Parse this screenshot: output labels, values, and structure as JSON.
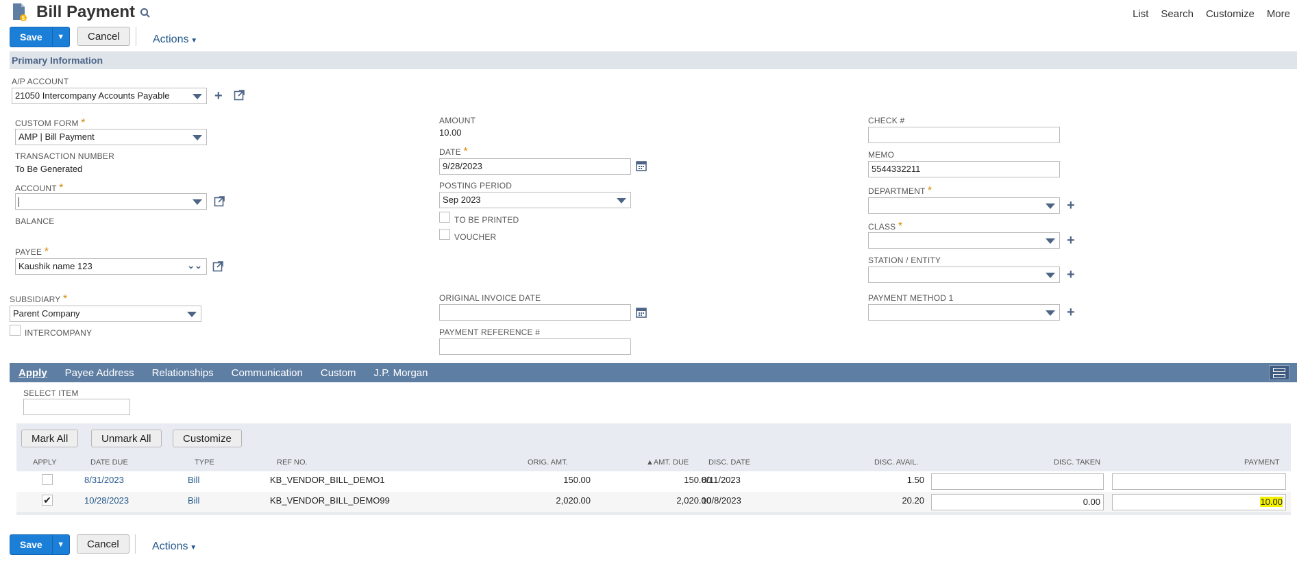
{
  "header": {
    "title": "Bill Payment",
    "links": [
      "List",
      "Search",
      "Customize",
      "More"
    ]
  },
  "toolbar": {
    "save_label": "Save",
    "cancel_label": "Cancel",
    "actions_label": "Actions"
  },
  "section_title": "Primary Information",
  "fields": {
    "ap_account_label": "A/P ACCOUNT",
    "ap_account_value": "21050 Intercompany Accounts Payable",
    "custom_form_label": "CUSTOM FORM",
    "custom_form_value": "AMP | Bill Payment",
    "transaction_number_label": "TRANSACTION NUMBER",
    "transaction_number_value": "To Be Generated",
    "account_label": "ACCOUNT",
    "account_value": "",
    "balance_label": "BALANCE",
    "payee_label": "PAYEE",
    "payee_value": "Kaushik name 123",
    "subsidiary_label": "SUBSIDIARY",
    "subsidiary_value": "Parent Company",
    "intercompany_label": "INTERCOMPANY",
    "amount_label": "AMOUNT",
    "amount_value": "10.00",
    "date_label": "DATE",
    "date_value": "9/28/2023",
    "posting_period_label": "POSTING PERIOD",
    "posting_period_value": "Sep 2023",
    "to_be_printed_label": "TO BE PRINTED",
    "voucher_label": "VOUCHER",
    "original_invoice_date_label": "ORIGINAL INVOICE DATE",
    "payment_reference_label": "PAYMENT REFERENCE #",
    "check_label": "CHECK #",
    "memo_label": "MEMO",
    "memo_value": "5544332211",
    "department_label": "DEPARTMENT",
    "class_label": "CLASS",
    "station_entity_label": "STATION / ENTITY",
    "payment_method_label": "PAYMENT METHOD 1"
  },
  "tabs": [
    "Apply",
    "Payee Address",
    "Relationships",
    "Communication",
    "Custom",
    "J.P. Morgan"
  ],
  "apply": {
    "select_item_label": "SELECT ITEM",
    "mark_all": "Mark All",
    "unmark_all": "Unmark All",
    "customize": "Customize",
    "columns": [
      "APPLY",
      "DATE DUE",
      "TYPE",
      "REF NO.",
      "ORIG. AMT.",
      "▲AMT. DUE",
      "DISC. DATE",
      "DISC. AVAIL.",
      "DISC. TAKEN",
      "PAYMENT"
    ],
    "rows": [
      {
        "checked": false,
        "date_due": "8/31/2023",
        "type": "Bill",
        "ref_no": "KB_VENDOR_BILL_DEMO1",
        "orig_amt": "150.00",
        "amt_due": "150.00",
        "disc_date": "8/11/2023",
        "disc_avail": "1.50",
        "disc_taken": "",
        "payment": ""
      },
      {
        "checked": true,
        "date_due": "10/28/2023",
        "type": "Bill",
        "ref_no": "KB_VENDOR_BILL_DEMO99",
        "orig_amt": "2,020.00",
        "amt_due": "2,020.00",
        "disc_date": "10/8/2023",
        "disc_avail": "20.20",
        "disc_taken": "0.00",
        "payment": "10.00"
      }
    ]
  },
  "colors": {
    "primary_button": "#1b7fd7",
    "tab_bar": "#5f7ea3",
    "section_bar": "#dfe4eb",
    "highlight": "#f3f000"
  }
}
